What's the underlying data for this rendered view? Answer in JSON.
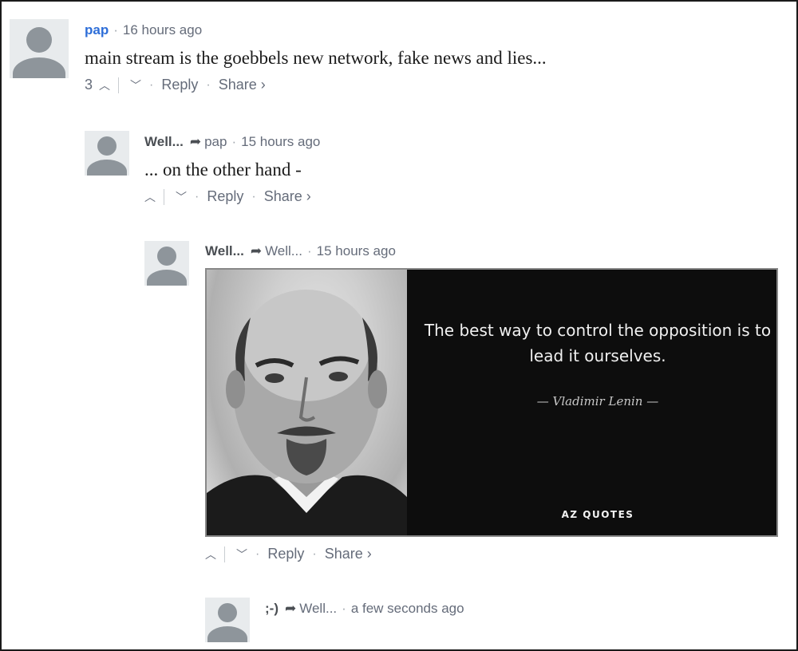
{
  "comments": [
    {
      "author": "pap",
      "time": "16 hours ago",
      "text": "main stream is the goebbels new network, fake news and lies...",
      "votes": "3",
      "reply_label": "Reply",
      "share_label": "Share ›"
    },
    {
      "author": "Well...",
      "reply_to": "pap",
      "time": "15 hours ago",
      "text": "... on the other hand -",
      "reply_label": "Reply",
      "share_label": "Share ›"
    },
    {
      "author": "Well...",
      "reply_to": "Well...",
      "time": "15 hours ago",
      "image": {
        "quote": "The best way to control the opposition is to lead it ourselves.",
        "quote_author": "— Vladimir Lenin —",
        "logo": "AZ QUOTES"
      },
      "reply_label": "Reply",
      "share_label": "Share ›"
    },
    {
      "author": ";-)",
      "reply_to": "Well...",
      "time": "a few seconds ago"
    }
  ],
  "colors": {
    "link_blue": "#2e6ed8",
    "meta_gray": "#656c7a",
    "avatar_bg": "#e8ebed",
    "avatar_fg": "#8e959b"
  },
  "icons": {
    "upvote": "chevron-up-icon",
    "downvote": "chevron-down-icon",
    "reply_to": "reply-arrow-icon",
    "avatar": "default-avatar-icon"
  }
}
